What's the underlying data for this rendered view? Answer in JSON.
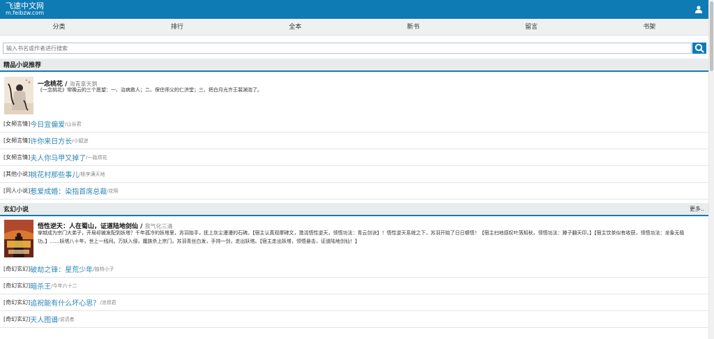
{
  "site": {
    "name": "飞速中文网",
    "domain": "m.feibzw.com"
  },
  "nav": {
    "items": [
      "分类",
      "排行",
      "全本",
      "新书",
      "留言",
      "书架"
    ]
  },
  "search": {
    "placeholder": "输入书名或作者进行搜索"
  },
  "sections": [
    {
      "title": "精品小说推荐",
      "more": "",
      "featured": {
        "title": "一念桃花",
        "author": "海青拿天鹅",
        "desc": "《一念桃花》常晚云的三个愿望：一、治病救人；二、保住师父的仁济堂；三、把白月光齐王裴渊泡了。"
      },
      "items": [
        {
          "cat": "[女频言情]",
          "title": "今日宜偏爱",
          "author": "/山谷君"
        },
        {
          "cat": "[女频言情]",
          "title": "许你来日方长",
          "author": "/小狐迷"
        },
        {
          "cat": "[女频言情]",
          "title": "夫人你马甲又掉了",
          "author": "/一路烦花"
        },
        {
          "cat": "[其他小说]",
          "title": "桃花村那些事儿",
          "author": "/桃李满天地"
        },
        {
          "cat": "[同人小说]",
          "title": "惹爱成婚：染指首席总裁",
          "author": "/花照"
        }
      ]
    },
    {
      "title": "玄幻小说",
      "more": "更多..",
      "featured": {
        "title": "悟性逆天：人在蜀山，证道陆地剑仙",
        "author": "我气化三清",
        "desc": "穿越成为宗门大弟子，开局却被发配到妖塔？千年孤冷的妖塔里，苏羽抬手，抚上灰尘漫漫的石碑。【宿主认真观摩碑文，激活悟性逆天，领悟功法：青云剑诀】！悟性逆天系统之下，苏羽开始了日日顿悟！【宿主扫地感叹叶落知秋，领悟功法：蹲子翻天印。】【宿主饮茶似有收获，领悟功法：龙象无极功。】……妖塔八十年，世上一线间。万妖入侵，魔族杀上宗门。苏羽青丝白发，手持一剑，走出妖塔。【宿主走出妖塔，领悟悬击，证道陆地剑仙！】"
      },
      "items": [
        {
          "cat": "[奇幻玄幻]",
          "title": "破劫之锋：星荒少年",
          "author": "/独特小子"
        },
        {
          "cat": "[奇幻玄幻]",
          "title": "暗杀王",
          "author": "/今年六十二"
        },
        {
          "cat": "[奇幻玄幻]",
          "title": "追祝能有什么坏心思？",
          "author": "/凉烦君"
        },
        {
          "cat": "[奇幻玄幻]",
          "title": "天人图谱",
          "author": "/说谎者"
        }
      ]
    }
  ]
}
